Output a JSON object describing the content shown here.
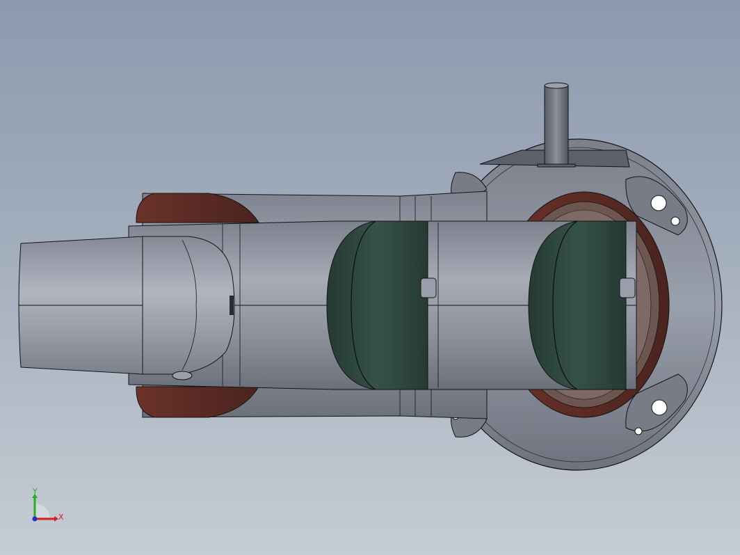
{
  "viewport": {
    "background_top": "#8c9aae",
    "background_bottom": "#c6ccd4"
  },
  "model": {
    "colors": {
      "steel": "#8d929e",
      "steel_light": "#b3b8c3",
      "steel_dark": "#5e636e",
      "rubber": "#5b2d26",
      "green_band": "#2f4a41",
      "outline": "#141414"
    }
  },
  "triad": {
    "x_label": "X",
    "y_label": "Y",
    "x_color": "#d02020",
    "y_color": "#20b020",
    "z_color": "#2030c8"
  }
}
